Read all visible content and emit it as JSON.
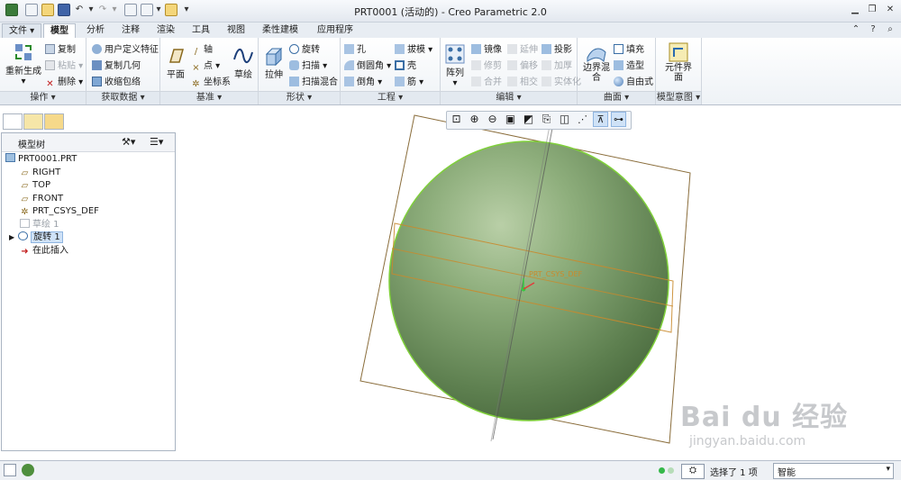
{
  "window": {
    "title": "PRT0001 (活动的) - Creo Parametric 2.0"
  },
  "tabs": [
    "文件",
    "模型",
    "分析",
    "注释",
    "渲染",
    "工具",
    "视图",
    "柔性建模",
    "应用程序"
  ],
  "ribbon": {
    "operations": {
      "regenerate": "重新生成",
      "copy": "复制",
      "paste": "粘贴",
      "delete": "删除",
      "label": "操作"
    },
    "get_data": {
      "udf": "用户定义特征",
      "copy_geom": "复制几何",
      "shrinkwrap": "收缩包络",
      "label": "获取数据"
    },
    "datum": {
      "plane": "平面",
      "axis": "轴",
      "point": "点",
      "csys": "坐标系",
      "sketch": "草绘",
      "label": "基准"
    },
    "shapes": {
      "extrude": "拉伸",
      "revolve": "旋转",
      "sweep": "扫描",
      "swept_blend": "扫描混合",
      "label": "形状"
    },
    "engineering": {
      "hole": "孔",
      "round": "倒圆角",
      "chamfer": "倒角",
      "draft": "拔模",
      "shell": "壳",
      "rib": "筋",
      "label": "工程"
    },
    "editing": {
      "pattern": "阵列",
      "mirror": "镜像",
      "trim": "修剪",
      "merge": "合并",
      "extend": "延伸",
      "offset": "偏移",
      "intersect": "相交",
      "project": "投影",
      "thicken": "加厚",
      "solidify": "实体化",
      "label": "编辑"
    },
    "surfaces": {
      "boundary_blend": "边界混合",
      "fill": "填充",
      "style": "造型",
      "freestyle": "自由式",
      "label": "曲面"
    },
    "model_intent": {
      "component_interface": "元件界面",
      "label": "模型意图"
    }
  },
  "model_tree": {
    "header": "模型树",
    "items": [
      {
        "label": "PRT0001.PRT",
        "type": "part"
      },
      {
        "label": "RIGHT",
        "type": "plane"
      },
      {
        "label": "TOP",
        "type": "plane"
      },
      {
        "label": "FRONT",
        "type": "plane"
      },
      {
        "label": "PRT_CSYS_DEF",
        "type": "csys"
      },
      {
        "label": "草绘 1",
        "type": "sketch",
        "dimmed": true
      },
      {
        "label": "旋转 1",
        "type": "revolve",
        "selected": true
      },
      {
        "label": "在此插入",
        "type": "insert"
      }
    ]
  },
  "graphics": {
    "csys_label": "PRT_CSYS_DEF",
    "sphere_color": "#6e9360"
  },
  "watermark": {
    "line1": "Bai du 经验",
    "line2": "jingyan.baidu.com"
  },
  "status_bar": {
    "selection": "选择了 1 项",
    "filter": "智能"
  },
  "colors": {
    "accent": "#2f6fb3",
    "selection": "#cfe2f7",
    "datum_orange": "#c98a2c"
  }
}
